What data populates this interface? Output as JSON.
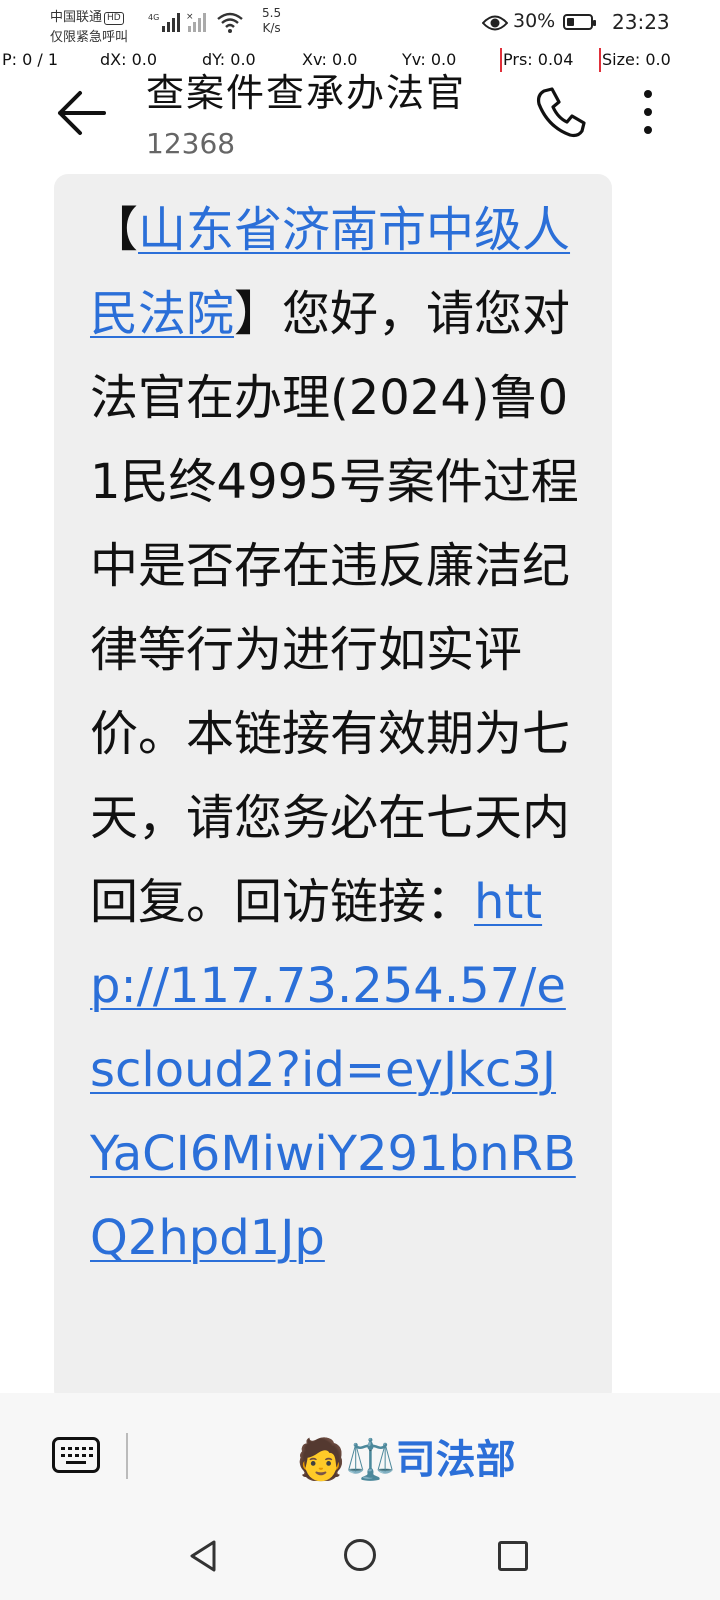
{
  "status_bar": {
    "carrier": "中国联通",
    "carrier_badge": "HD",
    "emergency_text": "仅限紧急呼叫",
    "network_type": "4G",
    "speed_value": "5.5",
    "speed_unit": "K/s",
    "battery_percent": "30%",
    "battery_level": 0.3,
    "time": "23:23"
  },
  "debug_overlay": {
    "pointer": "P: 0 / 1",
    "dx": "dX: 0.0",
    "dy": "dY: 0.0",
    "xv": "Xv: 0.0",
    "yv": "Yv: 0.0",
    "prs": "Prs: 0.04",
    "size": "Size: 0.0"
  },
  "header": {
    "title": "查案件查承办法官",
    "subtitle": "12368",
    "back_icon": "arrow-left-icon",
    "call_icon": "phone-icon",
    "more_icon": "more-vertical-icon"
  },
  "message": {
    "open_bracket": "【",
    "court_link": "山东省济南市中级人民法院",
    "body": "】您好，请您对法官在办理(2024)鲁01民终4995号案件过程中是否存在违反廉洁纪律等行为进行如实评价。本链接有效期为七天，请您务必在七天内回复。回访链接：",
    "url": "http://117.73.254.57/escloud2?id=eyJkc3JYaCI6MiwiY291bnRBQ2hpd1Jp"
  },
  "input_bar": {
    "keyboard_icon": "keyboard-icon",
    "sender_emoji": "🧑⚖️",
    "sender_name": "司法部"
  },
  "nav_bar": {
    "back_icon": "nav-back-icon",
    "home_icon": "nav-home-icon",
    "recents_icon": "nav-recents-icon"
  },
  "colors": {
    "link": "#2b6fd8",
    "bubble": "#efefef",
    "debug_marker": "#e0303a"
  }
}
